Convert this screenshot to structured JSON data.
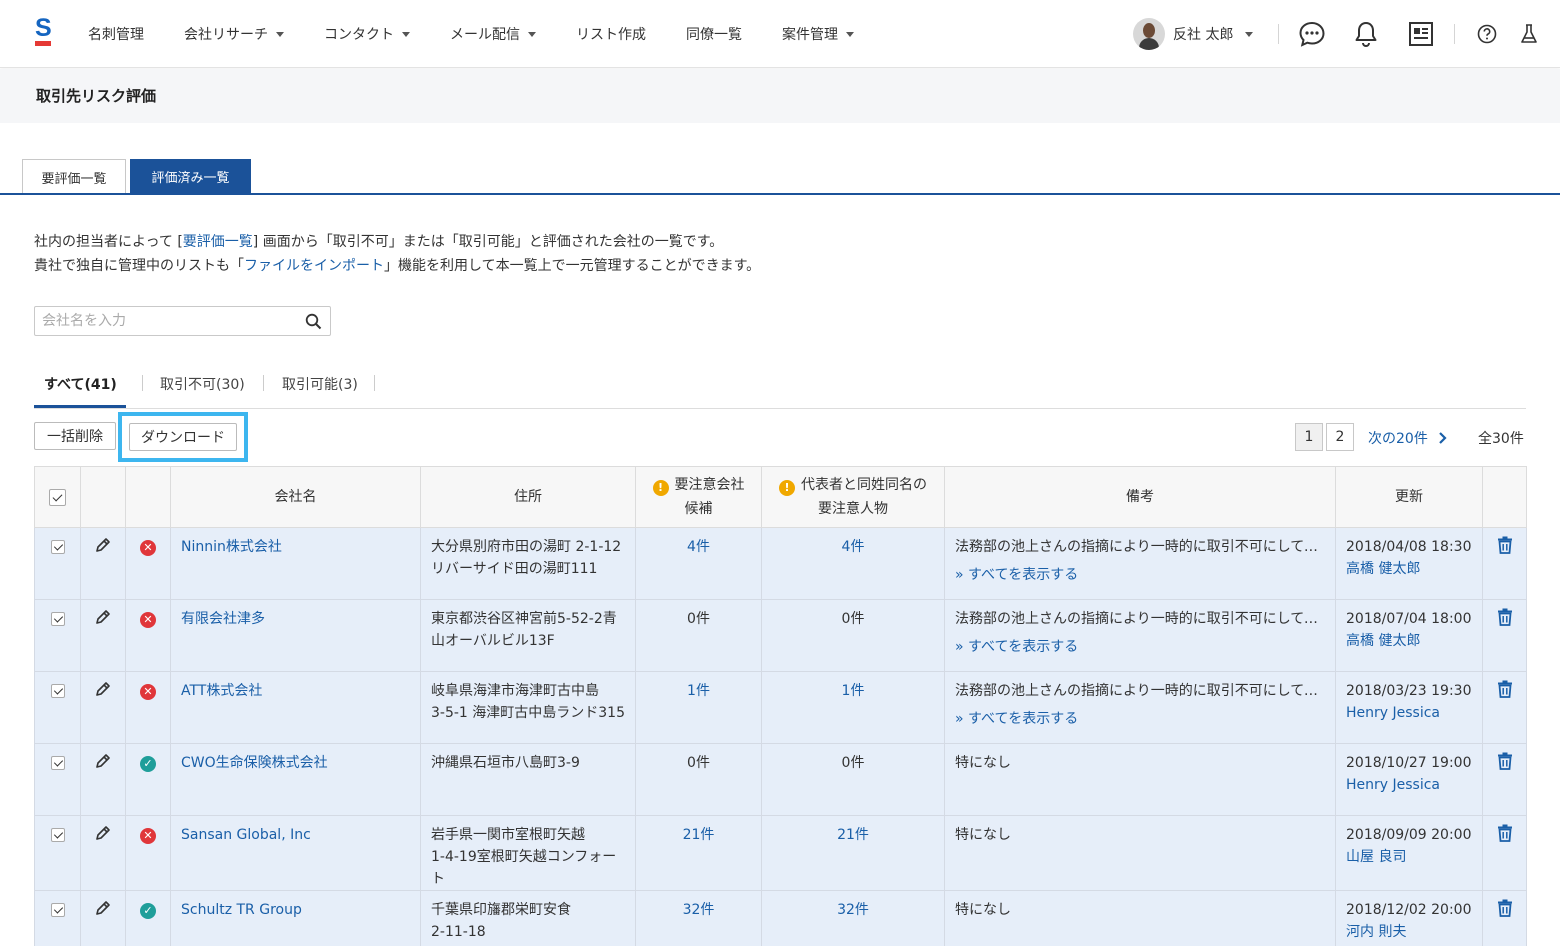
{
  "header": {
    "nav": [
      {
        "label": "名刺管理",
        "dropdown": false
      },
      {
        "label": "会社リサーチ",
        "dropdown": true
      },
      {
        "label": "コンタクト",
        "dropdown": true
      },
      {
        "label": "メール配信",
        "dropdown": true
      },
      {
        "label": "リスト作成",
        "dropdown": false
      },
      {
        "label": "同僚一覧",
        "dropdown": false
      },
      {
        "label": "案件管理",
        "dropdown": true
      }
    ],
    "user_name": "反社 太郎",
    "icons": [
      "chat-icon",
      "bell-icon",
      "news-icon",
      "help-icon",
      "flask-icon"
    ]
  },
  "page_title": "取引先リスク評価",
  "tabs": {
    "pending": "要評価一覧",
    "evaluated": "評価済み一覧"
  },
  "description": {
    "line1_before": "社内の担当者によって [",
    "line1_link": "要評価一覧",
    "line1_after": "] 画面から「取引不可」または「取引可能」と評価された会社の一覧です。",
    "line2_before": "貴社で独自に管理中のリストも「",
    "line2_link": "ファイルをインポート",
    "line2_after": "」機能を利用して本一覧上で一元管理することができます。"
  },
  "search": {
    "placeholder": "会社名を入力"
  },
  "filters": {
    "all": "すべて(41)",
    "ng": "取引不可(30)",
    "ok": "取引可能(3)"
  },
  "actions": {
    "bulk_delete": "一括削除",
    "download": "ダウンロード"
  },
  "pagination": {
    "page1": "1",
    "page2": "2",
    "next": "次の20件",
    "total": "全30件"
  },
  "table": {
    "headers": {
      "company": "会社名",
      "address": "住所",
      "caution_company_1": "要注意会社",
      "caution_company_2": "候補",
      "caution_person_1": "代表者と同姓同名の",
      "caution_person_2": "要注意人物",
      "note": "備考",
      "updated": "更新"
    },
    "show_all": "» すべてを表示する",
    "rows": [
      {
        "status": "ng",
        "company": "Ninnin株式会社",
        "addr1": "大分県別府市田の湯町 2-1-12",
        "addr2": "リバーサイド田の湯町111",
        "addr3": "",
        "cc": "4件",
        "cc_link": true,
        "cp": "4件",
        "cp_link": true,
        "note": "法務部の池上さんの指摘により一時的に取引不可にしてお…",
        "more": true,
        "date": "2018/04/08 18:30",
        "user": "高橋 健太郎"
      },
      {
        "status": "ng",
        "company": "有限会社津多",
        "addr1": "東京都渋谷区神宮前5-52-2青",
        "addr2": "山オーバルビル13F",
        "addr3": "",
        "cc": "0件",
        "cc_link": false,
        "cp": "0件",
        "cp_link": false,
        "note": "法務部の池上さんの指摘により一時的に取引不可にしてお…",
        "more": true,
        "date": "2018/07/04 18:00",
        "user": "高橋 健太郎"
      },
      {
        "status": "ng",
        "company": "ATT株式会社",
        "addr1": "岐阜県海津市海津町古中島",
        "addr2": "3-5-1 海津町古中島ランド315",
        "addr3": "",
        "cc": "1件",
        "cc_link": true,
        "cp": "1件",
        "cp_link": true,
        "note": "法務部の池上さんの指摘により一時的に取引不可にしてお…",
        "more": true,
        "date": "2018/03/23 19:30",
        "user": "Henry Jessica"
      },
      {
        "status": "ok",
        "company": "CWO生命保険株式会社",
        "addr1": "沖縄県石垣市八島町3-9",
        "addr2": "",
        "addr3": "",
        "cc": "0件",
        "cc_link": false,
        "cp": "0件",
        "cp_link": false,
        "note": "特になし",
        "more": false,
        "date": "2018/10/27 19:00",
        "user": "Henry Jessica"
      },
      {
        "status": "ng",
        "company": "Sansan Global, Inc",
        "addr1": "岩手県一関市室根町矢越",
        "addr2": "1-4-19室根町矢越コンフォー",
        "addr3": "ト",
        "cc": "21件",
        "cc_link": true,
        "cp": "21件",
        "cp_link": true,
        "note": "特になし",
        "more": false,
        "date": "2018/09/09 20:00",
        "user": "山屋 良司"
      },
      {
        "status": "ok",
        "company": "Schultz TR Group",
        "addr1": "千葉県印旛郡栄町安食",
        "addr2": " 2-11-18",
        "addr3": "",
        "cc": "32件",
        "cc_link": true,
        "cp": "32件",
        "cp_link": true,
        "note": "特になし",
        "more": false,
        "date": "2018/12/02 20:00",
        "user": "河内 則夫"
      }
    ]
  },
  "colors": {
    "brand": "#1b5299",
    "link": "#1a5fa8",
    "row_bg": "#e6eef9",
    "ng": "#e0363a",
    "ok": "#1f9e9a",
    "warn": "#f0a800",
    "highlight": "#3db6ef"
  }
}
